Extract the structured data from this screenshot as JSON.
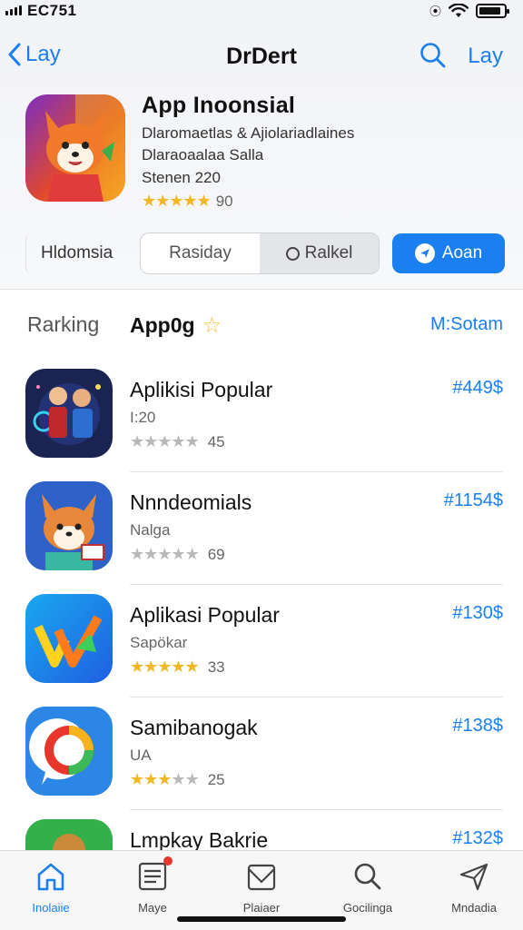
{
  "status": {
    "time": "EC751",
    "location_glyph": "⦿",
    "battery_level": 0.9
  },
  "nav": {
    "back_label": "Lay",
    "title": "DrDert",
    "right_label": "Lay"
  },
  "hero": {
    "name": "App  Inoonsial",
    "line1": "Dlaromaetlas & Ajiolariadlaines",
    "line2": "Dlaraoaalaa Salla",
    "line3": "Stenen 220",
    "rating": 5,
    "rating_text": "90"
  },
  "controls": {
    "chip_label": "Hldomsia",
    "seg_left": "Rasiday",
    "seg_right": "Ralkel",
    "cta_label": "Aoan"
  },
  "ranking": {
    "label": "Rarking",
    "app_label": "App0g",
    "more_label": "M:Sotam"
  },
  "apps": [
    {
      "title": "Aplikisi Popular",
      "sub": "I:20",
      "stars_filled": 0,
      "rating_text": "45",
      "rank": "#449$",
      "icon": "heroes-icon"
    },
    {
      "title": "Nnndeomials",
      "sub": "Nalga",
      "stars_filled": 0,
      "rating_text": "69",
      "rank": "#1154$",
      "icon": "fox-icon"
    },
    {
      "title": "Aplikasi Popular",
      "sub": "Sapökar",
      "stars_filled": 5,
      "rating_text": "33",
      "rank": "#130$",
      "icon": "v-logo-icon"
    },
    {
      "title": "Samibanogak",
      "sub": "UA",
      "stars_filled": 3,
      "rating_text": "25",
      "rank": "#138$",
      "icon": "ring-icon"
    },
    {
      "title": "Lmpkay Bakrie",
      "sub": "",
      "stars_filled": 0,
      "rating_text": "",
      "rank": "#132$",
      "icon": "green-app-icon"
    }
  ],
  "tabs": [
    {
      "label": "Inolaiie",
      "icon": "home-icon"
    },
    {
      "label": "Maye",
      "icon": "news-icon"
    },
    {
      "label": "Plaiaer",
      "icon": "mail-icon"
    },
    {
      "label": "Gocilinga",
      "icon": "search-icon"
    },
    {
      "label": "Mndadia",
      "icon": "send-icon"
    }
  ],
  "colors": {
    "accent": "#1a7ff0",
    "star": "#f2b722"
  }
}
